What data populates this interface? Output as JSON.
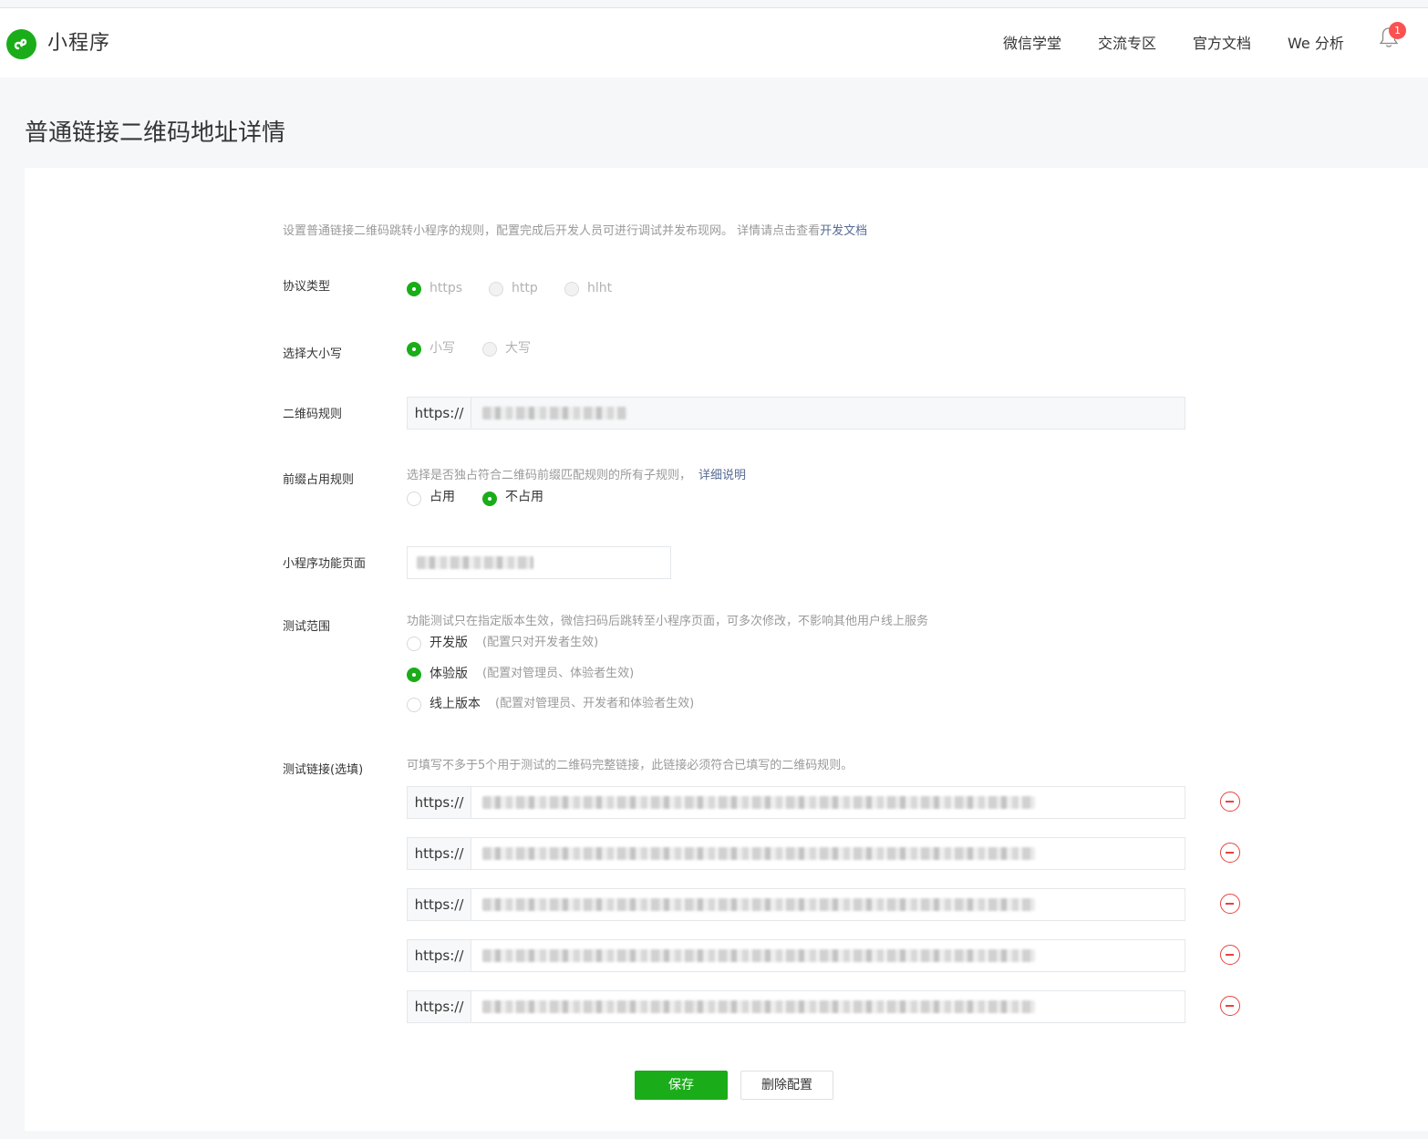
{
  "header": {
    "brand": "小程序",
    "nav": [
      "微信学堂",
      "交流专区",
      "官方文档",
      "We 分析"
    ],
    "notification_count": "1"
  },
  "page": {
    "title": "普通链接二维码地址详情"
  },
  "intro": {
    "text": "设置普通链接二维码跳转小程序的规则，配置完成后开发人员可进行调试并发布现网。 详情请点击查看",
    "link": "开发文档"
  },
  "protocol": {
    "label": "协议类型",
    "options": [
      "https",
      "http",
      "hlht"
    ],
    "selected": "https"
  },
  "case": {
    "label": "选择大小写",
    "options": [
      "小写",
      "大写"
    ],
    "selected": "小写"
  },
  "qr_rule": {
    "label": "二维码规则",
    "prefix": "https://"
  },
  "prefix_rule": {
    "label": "前缀占用规则",
    "desc": "选择是否独占符合二维码前缀匹配规则的所有子规则，",
    "link": "详细说明",
    "options": [
      "占用",
      "不占用"
    ],
    "selected": "不占用"
  },
  "mp_page": {
    "label": "小程序功能页面"
  },
  "test_scope": {
    "label": "测试范围",
    "desc": "功能测试只在指定版本生效，微信扫码后跳转至小程序页面，可多次修改，不影响其他用户线上服务",
    "options": [
      {
        "name": "开发版",
        "hint": "(配置只对开发者生效)"
      },
      {
        "name": "体验版",
        "hint": "(配置对管理员、体验者生效)"
      },
      {
        "name": "线上版本",
        "hint": "(配置对管理员、开发者和体验者生效)"
      }
    ],
    "selected": "体验版"
  },
  "test_links": {
    "label": "测试链接(选填)",
    "desc": "可填写不多于5个用于测试的二维码完整链接，此链接必须符合已填写的二维码规则。",
    "prefix": "https://",
    "count": 5
  },
  "actions": {
    "save": "保存",
    "delete": "删除配置"
  },
  "colors": {
    "accent": "#1aad19",
    "link": "#576b95",
    "danger": "#e64340"
  }
}
